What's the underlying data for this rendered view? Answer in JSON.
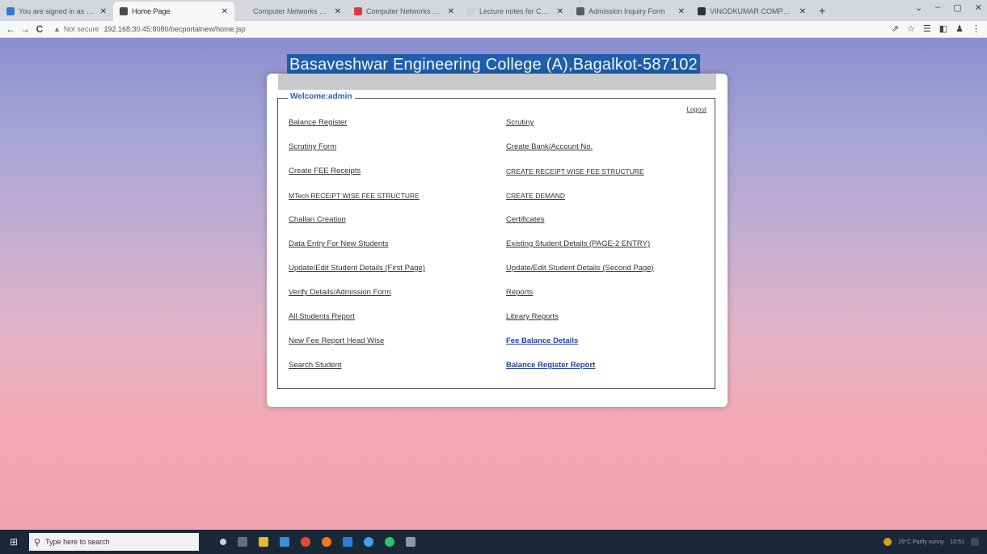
{
  "browser": {
    "tabs": [
      {
        "title": "You are signed in as Lecturer",
        "favicon_color": "#2f7bd6",
        "active": false
      },
      {
        "title": "Home Page",
        "favicon_color": "#4a4a4a",
        "active": true
      },
      {
        "title": "Computer Networks Notes KCS",
        "favicon_color": "#d9d9d9",
        "active": false
      },
      {
        "title": "Computer Networks Notes KCS",
        "favicon_color": "#e03a3a",
        "active": false
      },
      {
        "title": "Lecture notes for Computer N",
        "favicon_color": "#cfcfcf",
        "active": false
      },
      {
        "title": "Admission Inquiry Form",
        "favicon_color": "#5a5a5a",
        "active": false
      },
      {
        "title": "VINODKUMAR COMPUTER SC",
        "favicon_color": "#333333",
        "active": false
      }
    ],
    "new_tab": "+",
    "window_controls": [
      "⌄",
      "–",
      "▢",
      "✕"
    ],
    "nav": {
      "back": "←",
      "forward": "→",
      "reload": "C"
    },
    "security_icon": "▲",
    "security_text": "Not secure",
    "url": "192.168.30.45:8080/becportalnew/home.jsp",
    "toolbar_icons": [
      "⇗",
      "☆",
      "☰",
      "◧",
      "♟",
      "⋮"
    ]
  },
  "page": {
    "college_title": "Basaveshwar Engineering College (A),Bagalkot-587102",
    "welcome": "Welcome:admin",
    "logout": "Logout",
    "left_links": [
      "Balance Register",
      "Scrutiny Form",
      "Create FEE Receipts",
      "MTech RECEIPT WISE FEE STRUCTURE",
      "Challan Creation",
      "Data Entry For New Students",
      "Update/Edit Student Details (First Page)",
      "Verify Details/Admission Form",
      "All Students Report",
      "New Fee Report Head Wise",
      "Search Student"
    ],
    "right_links": [
      "Scrutiny",
      "Create Bank/Account No.",
      "CREATE RECEIPT WISE FEE STRUCTURE",
      "CREATE DEMAND",
      "Certificates",
      "Existing Student Details (PAGE-2 ENTRY)",
      "Update/Edit Student Details (Second Page)",
      "Reports",
      "Library Reports",
      "Fee Balance Details",
      "Balance Register Report"
    ]
  },
  "taskbar": {
    "search_placeholder": "Type here to search",
    "tray_text": "29°C  Partly sunny",
    "time": "10:51"
  }
}
